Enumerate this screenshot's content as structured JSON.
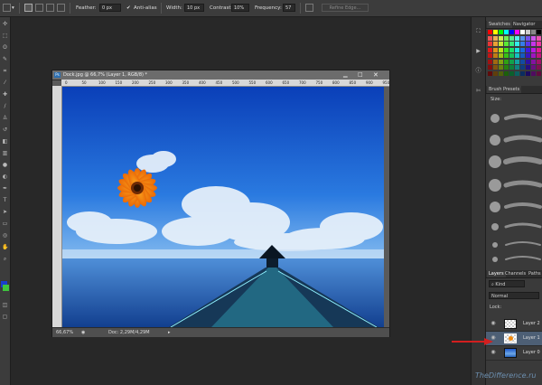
{
  "options_bar": {
    "feather_label": "Feather:",
    "feather_value": "0 px",
    "antialias_label": "Anti-alias",
    "width_label": "Width:",
    "width_value": "10 px",
    "contrast_label": "Contrast:",
    "contrast_value": "10%",
    "frequency_label": "Frequency:",
    "frequency_value": "57",
    "refine_edge_label": "Refine Edge..."
  },
  "document": {
    "title": "Dock.jpg @ 66,7% (Layer 1, RGB/8) *",
    "zoom": "66,67%",
    "doc_size": "Doc: 2,29M/4,29M",
    "ruler_marks": [
      "0",
      "50",
      "100",
      "150",
      "200",
      "250",
      "300",
      "350",
      "400",
      "450",
      "500",
      "550",
      "600",
      "650",
      "700",
      "750",
      "800",
      "850",
      "900",
      "950"
    ]
  },
  "panels": {
    "swatches_tab": "Swatches",
    "navigator_tab": "Navigator",
    "brush_presets_tab": "Brush Presets",
    "size_label": "Size:",
    "layers_tab": "Layers",
    "channels_tab": "Channels",
    "paths_tab": "Paths",
    "kind_label": "Kind",
    "blend_mode": "Normal",
    "lock_label": "Lock:",
    "layers": [
      {
        "name": "Layer 2"
      },
      {
        "name": "Layer 1"
      },
      {
        "name": "Layer 0"
      }
    ]
  },
  "colors": {
    "foreground": "#1a3ecf",
    "background": "#3ec43e",
    "annotation_arrow": "#d21f1f"
  },
  "watermark": "TheDifference.ru"
}
